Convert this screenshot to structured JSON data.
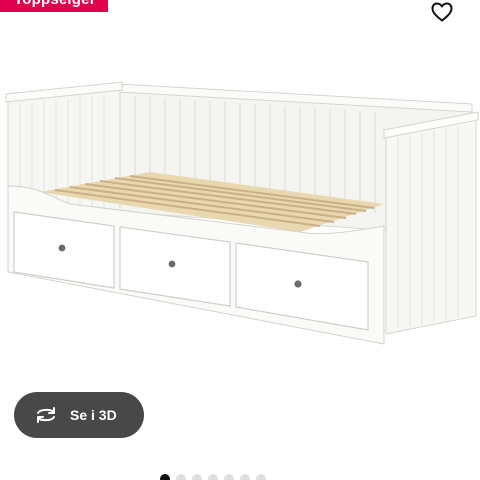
{
  "badge": {
    "label": "Toppselger"
  },
  "favorite": {
    "icon": "heart-icon"
  },
  "viewer": {
    "button_label": "Se i 3D",
    "button_icon": "rotate-3d-icon"
  },
  "carousel": {
    "count": 7,
    "active_index": 0
  },
  "colors": {
    "badge_bg": "#e0004d",
    "button_bg": "#484848",
    "dot_active": "#111111",
    "dot_inactive": "#dfdfdf"
  }
}
